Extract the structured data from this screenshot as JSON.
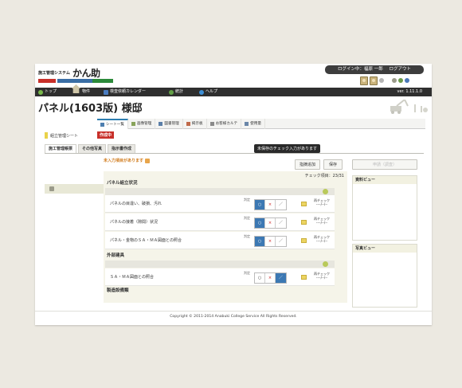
{
  "header": {
    "system_label": "施工管理システム",
    "logo_text": "かん助",
    "login_status": "ログイン中：福原 一郎",
    "logout_label": "ログアウト",
    "colors": {
      "bar_red": "#c8302a",
      "bar_blue": "#3a6ea5",
      "bar_green": "#2c8a3a"
    }
  },
  "nav": {
    "items": [
      {
        "label": "トップ",
        "icon": "top-icon",
        "color": "#78b84a"
      },
      {
        "label": "物件",
        "icon": "home-icon",
        "color": "#cfc6a8"
      },
      {
        "label": "検査依頼カレンダー",
        "icon": "calendar-icon",
        "color": "#4a7cc0"
      },
      {
        "label": "統計",
        "icon": "stats-icon",
        "color": "#62a046"
      },
      {
        "label": "ヘルプ",
        "icon": "help-icon",
        "color": "#3d8fd6"
      }
    ],
    "version": "ver. 1.11.1.0"
  },
  "page_title": "パネル(1603版) 様邸",
  "subtabs": [
    {
      "label": "シート一覧",
      "active": true
    },
    {
      "label": "画像管理",
      "active": false
    },
    {
      "label": "図書管理",
      "active": false
    },
    {
      "label": "掲示板",
      "active": false
    },
    {
      "label": "お客様カルテ",
      "active": false
    },
    {
      "label": "使用量",
      "active": false
    }
  ],
  "sheet": {
    "name": "組立管理シート",
    "status_badge": "作成中"
  },
  "doc_tabs": [
    "施工管理帳票",
    "その他写真",
    "指示書作成"
  ],
  "tooltip": "未保存のチェック入力があります",
  "warning": "未入力項目があります",
  "buttons": {
    "add_instruction": "指摘追加",
    "save": "保存",
    "apply": "申請（調査）"
  },
  "checklist": {
    "count_label": "チェック項目：23/31",
    "judge_label": "判定",
    "recheck_label": "再チェック",
    "recheck_date": "----/--/--",
    "options": [
      "○",
      "×",
      "／"
    ],
    "sections": [
      {
        "title": "パネル組立状況",
        "rows": [
          {
            "name": "パネルの目違い、破損、汚れ",
            "selected": 0
          },
          {
            "name": "パネルの接着（隙間）状況",
            "selected": 0
          },
          {
            "name": "パネル・金物のＳＡ・ＭＡ図面との照合",
            "selected": 0
          }
        ]
      },
      {
        "title": "外部建具",
        "rows": [
          {
            "name": "ＳＡ・ＭＡ図面との照合",
            "selected": 2
          }
        ]
      },
      {
        "title": "製造設備類",
        "rows": []
      }
    ]
  },
  "panels": {
    "document_view": "資料ビュー",
    "photo_view": "写真ビュー"
  },
  "footer": "Copyright © 2011-2014 Anabuki College Service All Rights Reserved."
}
